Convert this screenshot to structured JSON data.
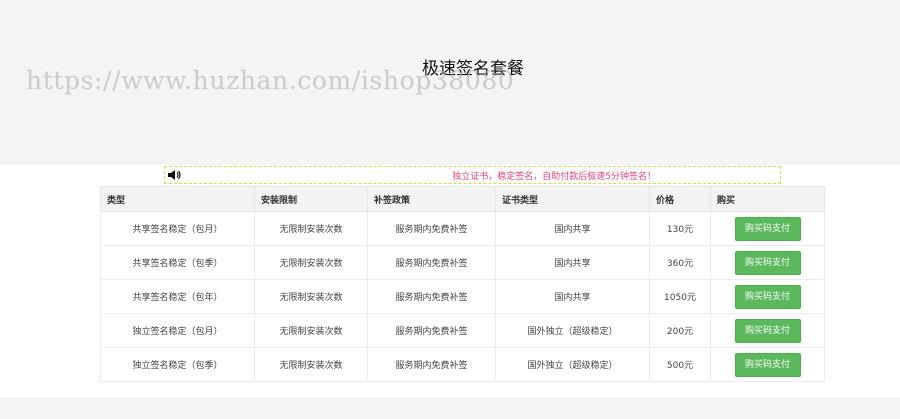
{
  "page": {
    "title": "极速签名套餐",
    "watermark": "https://www.huzhan.com/ishop38080"
  },
  "notice": {
    "icon": "speaker-icon",
    "text": "独立证书，稳定签名，自助付款后极速5分钟签名！"
  },
  "table": {
    "headers": [
      "类型",
      "安装限制",
      "补签政策",
      "证书类型",
      "价格",
      "购买"
    ],
    "rows": [
      {
        "type": "共享签名稳定（包月）",
        "type_color": "black",
        "limit": "无限制安装次数",
        "policy": "服务期内免费补签",
        "cert": "国内共享",
        "price": "130元",
        "price_color": "black",
        "buy": "购买码支付"
      },
      {
        "type": "共享签名稳定（包季）",
        "type_color": "black",
        "limit": "无限制安装次数",
        "policy": "服务期内免费补签",
        "cert": "国内共享",
        "price": "360元",
        "price_color": "black",
        "buy": "购买码支付"
      },
      {
        "type": "共享签名稳定（包年）",
        "type_color": "black",
        "limit": "无限制安装次数",
        "policy": "服务期内免费补签",
        "cert": "国内共享",
        "price": "1050元",
        "price_color": "black",
        "buy": "购买码支付"
      },
      {
        "type": "独立签名稳定（包月）",
        "type_color": "red",
        "limit": "无限制安装次数",
        "policy": "服务期内免费补签",
        "cert": "国外独立（超级稳定）",
        "price": "200元",
        "price_color": "red",
        "buy": "购买码支付"
      },
      {
        "type": "独立签名稳定（包季）",
        "type_color": "red",
        "limit": "无限制安装次数",
        "policy": "服务期内免费补签",
        "cert": "国外独立（超级稳定）",
        "price": "500元",
        "price_color": "red",
        "buy": "购买码支付"
      }
    ]
  },
  "colors": {
    "accent_green_button": "#5cb85c",
    "red_text": "#e8222b",
    "green_text": "#1d8a1d",
    "notice_text": "#e0457b",
    "notice_border": "#d4e04a"
  }
}
